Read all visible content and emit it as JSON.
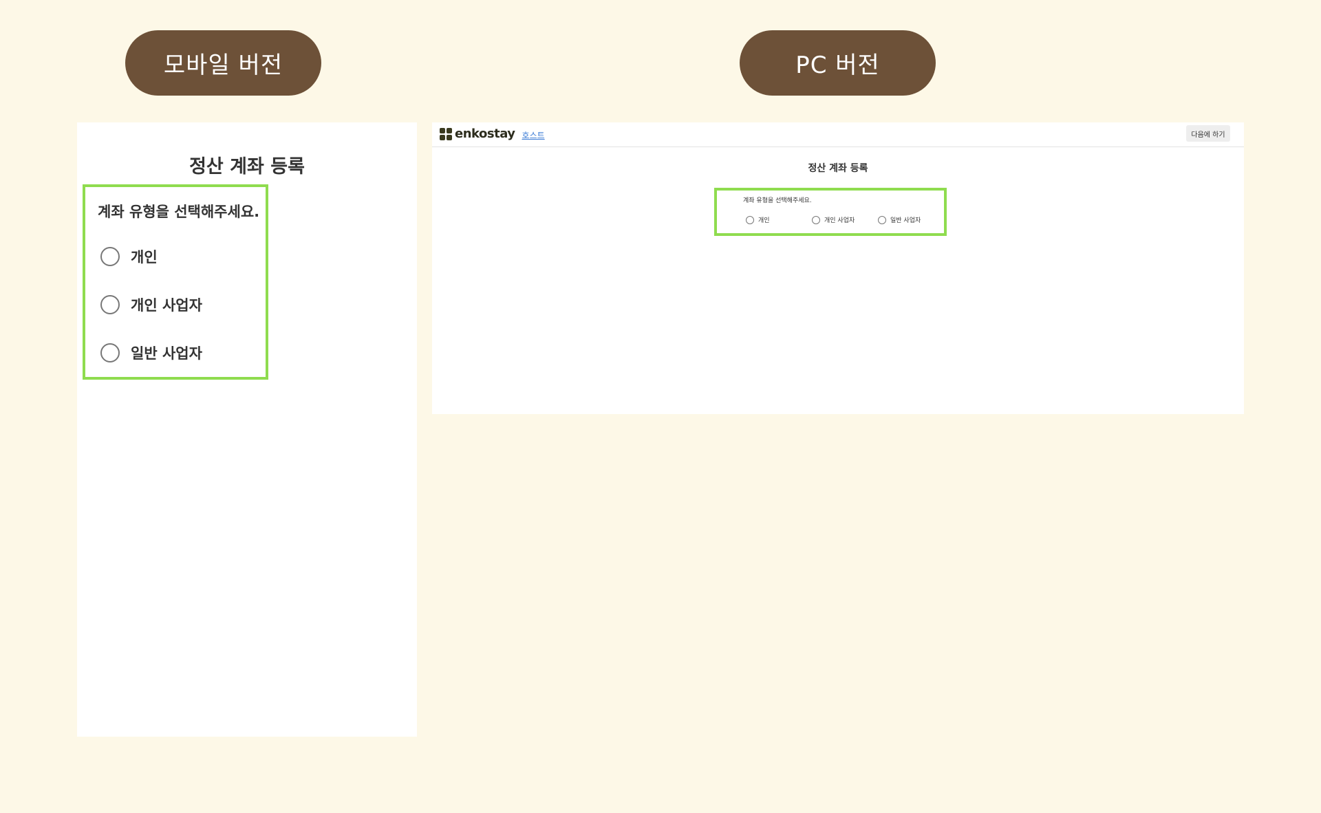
{
  "badges": {
    "mobile": "모바일 버전",
    "pc": "PC 버전"
  },
  "mobile": {
    "title": "정산 계좌 등록",
    "question": "계좌 유형을 선택해주세요.",
    "options": [
      "개인",
      "개인 사업자",
      "일반 사업자"
    ]
  },
  "pc": {
    "logo_text": "enkostay",
    "host_link": "호스트",
    "next_button": "다음에 하기",
    "title": "정산 계좌 등록",
    "question": "계좌 유형을 선택해주세요.",
    "options": [
      "개인",
      "개인 사업자",
      "일반 사업자"
    ]
  },
  "colors": {
    "background": "#fdf8e7",
    "badge": "#6d5138",
    "highlight_border": "#8fdc4f"
  }
}
